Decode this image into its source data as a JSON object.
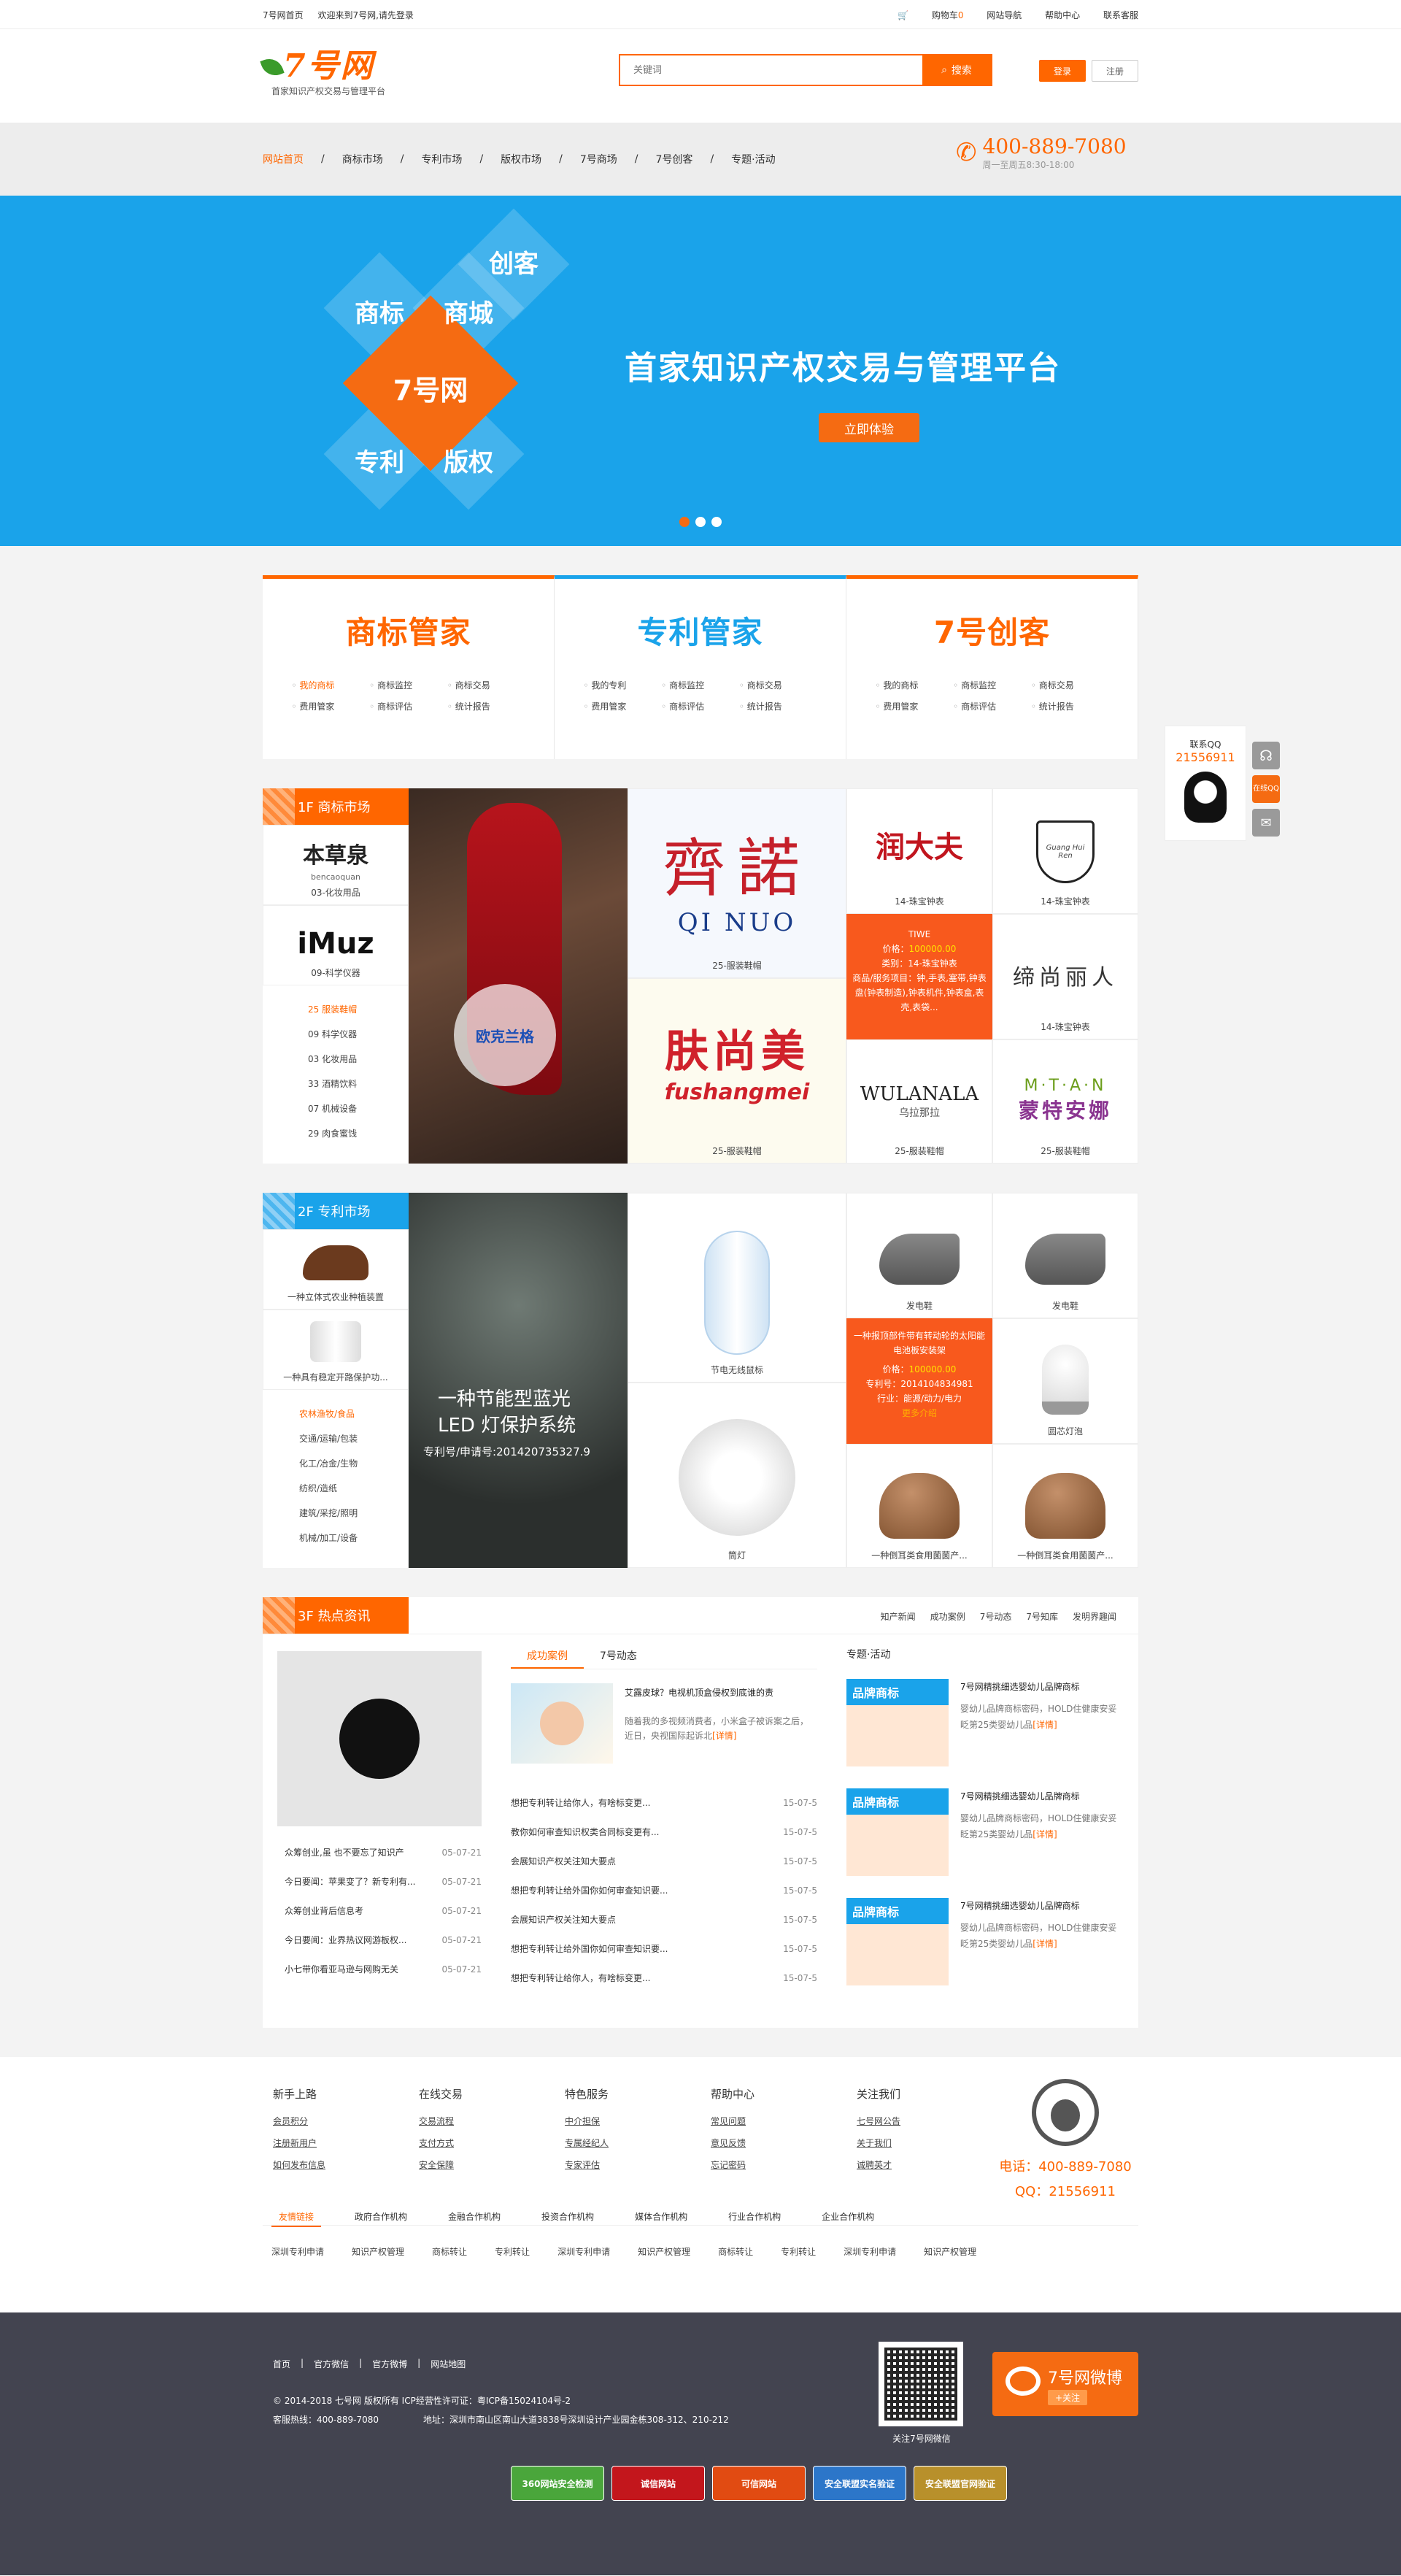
{
  "topbar": {
    "site_home": "7号网首页",
    "welcome": "欢迎来到7号网,请先登录",
    "cart_label": "购物车",
    "cart_count": "0",
    "site_nav": "网站导航",
    "help": "帮助中心",
    "service": "联系客服"
  },
  "header": {
    "logo_text": "7号网",
    "logo_sub": "首家知识产权交易与管理平台",
    "search_placeholder": "关键词",
    "search_button": "搜索",
    "login": "登录",
    "register": "注册"
  },
  "nav": {
    "items": [
      "网站首页",
      "商标市场",
      "专利市场",
      "版权市场",
      "7号商场",
      "7号创客",
      "专题·活动"
    ],
    "hotline": "400-889-7080",
    "hotline_sub": "周一至周五8:30-18:00"
  },
  "banner": {
    "tiles": [
      "商标",
      "商城",
      "创客",
      "专利",
      "版权"
    ],
    "center": "7号网",
    "title": "首家知识产权交易与管理平台",
    "cta": "立即体验"
  },
  "services": [
    {
      "title": "商标管家",
      "links": [
        "我的商标",
        "商标监控",
        "商标交易",
        "费用管家",
        "商标评估",
        "统计报告"
      ]
    },
    {
      "title": "专利管家",
      "links": [
        "我的专利",
        "商标监控",
        "商标交易",
        "费用管家",
        "商标评估",
        "统计报告"
      ]
    },
    {
      "title": "7号创客",
      "links": [
        "我的商标",
        "商标监控",
        "商标交易",
        "费用管家",
        "商标评估",
        "统计报告"
      ]
    }
  ],
  "floor1": {
    "tag": "1F 商标市场",
    "left_items": [
      {
        "logo": "本草泉",
        "logo_sub": "bencaoquan",
        "cap": "03-化妆用品"
      },
      {
        "logo": "iMuz",
        "cap": "09-科学仪器"
      }
    ],
    "categories": [
      "25 服装鞋帽",
      "09 科学仪器",
      "03 化妆用品",
      "33 酒精饮料",
      "07 机械设备",
      "29 肉食蜜饯"
    ],
    "banner_logo": "欧克兰格",
    "brands": [
      {
        "name": "齊諾",
        "sub": "QI NUO",
        "cap": "25-服装鞋帽"
      },
      {
        "name": "润大夫",
        "cap": "14-珠宝钟表"
      },
      {
        "name": "Guang Hui Ren",
        "cap": "14-珠宝钟表"
      },
      {
        "name": "缔尚丽人",
        "cap": "14-珠宝钟表"
      },
      {
        "name": "肤尚美",
        "sub": "fushangmei",
        "cap": "25-服装鞋帽"
      },
      {
        "name": "WULANALA",
        "sub": "乌拉那拉",
        "cap": "25-服装鞋帽"
      },
      {
        "name": "M·T·A·N",
        "sub": "蒙特安娜",
        "cap": "25-服装鞋帽"
      }
    ],
    "hover": {
      "name": "TIWE",
      "price_label": "价格：",
      "price": "100000.00",
      "cat": "类别：14-珠宝钟表",
      "desc": "商品/服务项目：钟,手表,塞带,钟表盘(钟表制造),钟表机件,钟表盒,表壳,表袋..."
    }
  },
  "floor2": {
    "tag": "2F 专利市场",
    "left_items": [
      {
        "cap": "一种立体式农业种植装置"
      },
      {
        "cap": "一种具有稳定开路保护功..."
      }
    ],
    "categories": [
      "农林渔牧/食品",
      "交通/运输/包装",
      "化工/冶金/生物",
      "纺织/造纸",
      "建筑/采挖/照明",
      "机械/加工/设备"
    ],
    "banner_title": "一种节能型蓝光",
    "banner_title2": "LED 灯保护系统",
    "banner_sub": "专利号/申请号:201420735327.9",
    "items": [
      {
        "cap": "节电无线鼠标"
      },
      {
        "cap": "发电鞋"
      },
      {
        "cap": "发电鞋"
      },
      {
        "cap": "筒灯"
      },
      {
        "cap": "圆芯灯泡"
      },
      {
        "cap": "一种倒耳类食用菌菌产..."
      },
      {
        "cap": "一种倒耳类食用菌菌产..."
      }
    ],
    "hover": {
      "title": "一种报顶部件带有转动轮的太阳能电池板安装架",
      "price_label": "价格：",
      "price": "100000.00",
      "patent": "专利号：2014104834981",
      "industry": "行业：能源/动力/电力",
      "more": "更多介绍"
    }
  },
  "floor3": {
    "tag": "3F 热点资讯",
    "tabs_right": [
      "知产新闻",
      "成功案例",
      "7号动态",
      "7号知库",
      "发明界趣闻"
    ],
    "left_news": [
      {
        "title": "众筹创业,虽 也不要忘了知识产",
        "date": "05-07-21"
      },
      {
        "title": "今日要闻：苹果变了？新专利有...",
        "date": "05-07-21"
      },
      {
        "title": "众筹创业背后信息考",
        "date": "05-07-21"
      },
      {
        "title": "今日要闻：业界热议网游板权...",
        "date": "05-07-21"
      },
      {
        "title": "小七带你看亚马逊与网购无关",
        "date": "05-07-21"
      }
    ],
    "mid_tabs": [
      "成功案例",
      "7号动态"
    ],
    "feature": {
      "title": "艾露皮球？电视机顶盒侵权到底谁的责",
      "text": "随着我的多视频消费者，小米盒子被诉案之后，近日，央视国际起诉北",
      "more": "[详情]"
    },
    "mid_news": [
      {
        "title": "想把专利转让给你人，有啥标变更...",
        "date": "15-07-5"
      },
      {
        "title": "教你如何审查知识权类合同标变更有...",
        "date": "15-07-5"
      },
      {
        "title": "会展知识产权关注知大要点",
        "date": "15-07-5"
      },
      {
        "title": "想把专利转让给外国你如何审查知识要...",
        "date": "15-07-5"
      },
      {
        "title": "会展知识产权关注知大要点",
        "date": "15-07-5"
      },
      {
        "title": "想把专利转让给外国你如何审查知识要...",
        "date": "15-07-5"
      },
      {
        "title": "想把专利转让给你人，有啥标变更...",
        "date": "15-07-5"
      }
    ],
    "topic_title": "专题·活动",
    "topics": [
      {
        "title": "7号网精挑细选婴幼儿品牌商标",
        "text": "婴幼儿品牌商标密码，HOLD住健康安妥眨第25类婴幼儿品",
        "more": "[详情]"
      },
      {
        "title": "7号网精挑细选婴幼儿品牌商标",
        "text": "婴幼儿品牌商标密码，HOLD住健康安妥眨第25类婴幼儿品",
        "more": "[详情]"
      },
      {
        "title": "7号网精挑细选婴幼儿品牌商标",
        "text": "婴幼儿品牌商标密码，HOLD住健康安妥眨第25类婴幼儿品",
        "more": "[详情]"
      }
    ],
    "topic_img_text": "品牌商标"
  },
  "footer": {
    "cols": [
      {
        "title": "新手上路",
        "items": [
          "会员积分",
          "注册新用户",
          "如何发布信息"
        ]
      },
      {
        "title": "在线交易",
        "items": [
          "交易流程",
          "支付方式",
          "安全保障"
        ]
      },
      {
        "title": "特色服务",
        "items": [
          "中介担保",
          "专属经纪人",
          "专家评估"
        ]
      },
      {
        "title": "帮助中心",
        "items": [
          "常见问题",
          "意见反馈",
          "忘记密码"
        ]
      },
      {
        "title": "关注我们",
        "items": [
          "七号网公告",
          "关于我们",
          "诚聘英才"
        ]
      }
    ],
    "phone": "电话：400-889-7080",
    "qq": "QQ：21556911",
    "partner_tabs": [
      "友情链接",
      "政府合作机构",
      "金融合作机构",
      "投资合作机构",
      "媒体合作机构",
      "行业合作机构",
      "企业合作机构"
    ],
    "partner_links": [
      "深圳专利申请",
      "知识产权管理",
      "商标转让",
      "专利转让",
      "深圳专利申请",
      "知识产权管理",
      "商标转让",
      "专利转让",
      "深圳专利申请",
      "知识产权管理"
    ]
  },
  "bottom": {
    "links": [
      "首页",
      "官方微信",
      "官方微博",
      "网站地图"
    ],
    "copyright": "© 2014-2018 七号网 版权所有 ICP经营性许可证：粤ICP备15024104号-2",
    "hotline": "客服热线：400-889-7080",
    "address": "地址：深圳市南山区南山大道3838号深圳设计产业园金栋308-312、210-212",
    "qr_caption": "关注7号网微信",
    "weibo": "7号网微博",
    "follow": "+关注",
    "badges": [
      "360网站安全检测",
      "诚信网站",
      "可信网站",
      "安全联盟实名验证",
      "安全联盟官网验证"
    ]
  },
  "float_qq": {
    "title": "联系QQ",
    "number": "21556911",
    "online": "在线QQ"
  }
}
